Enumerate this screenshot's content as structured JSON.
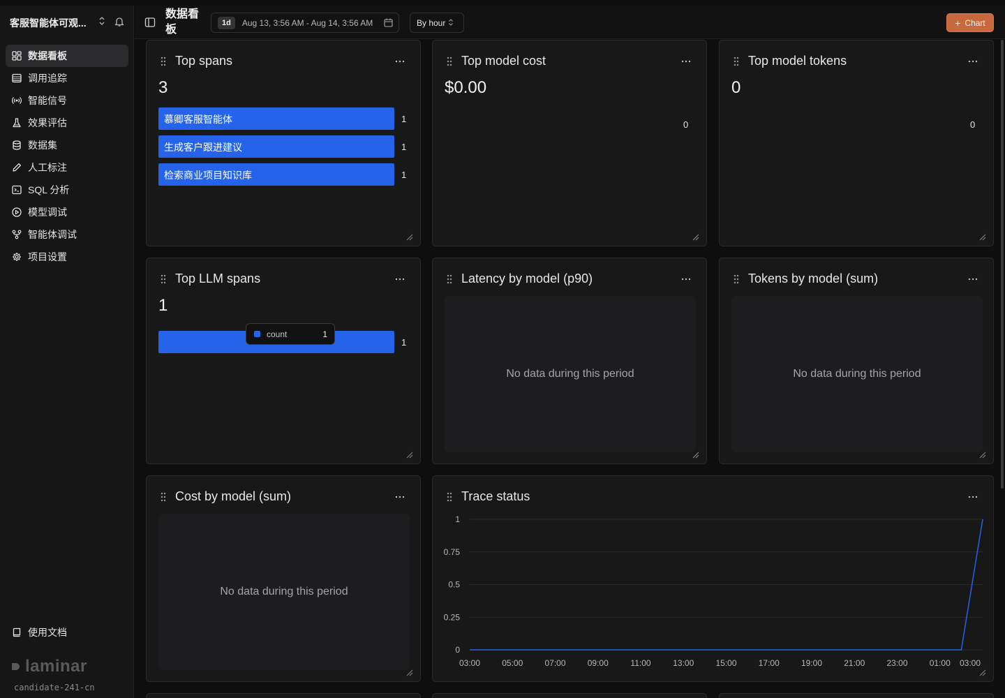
{
  "sidebar": {
    "project_name": "客服智能体可观...",
    "nav": [
      {
        "label": "数据看板",
        "icon": "dashboard-icon",
        "active": true
      },
      {
        "label": "调用追踪",
        "icon": "list-icon"
      },
      {
        "label": "智能信号",
        "icon": "radio-signal-icon"
      },
      {
        "label": "效果评估",
        "icon": "flask-icon"
      },
      {
        "label": "数据集",
        "icon": "database-icon"
      },
      {
        "label": "人工标注",
        "icon": "pencil-icon"
      },
      {
        "label": "SQL 分析",
        "icon": "terminal-icon"
      },
      {
        "label": "模型调试",
        "icon": "play-circle-icon"
      },
      {
        "label": "智能体调试",
        "icon": "git-branch-icon"
      },
      {
        "label": "项目设置",
        "icon": "gear-icon"
      }
    ],
    "docs_label": "使用文档",
    "logo_text": "laminar",
    "workspace": "candidate-241-cn"
  },
  "header": {
    "title": "数据看板",
    "range_chip": "1d",
    "range_text": "Aug 13, 3:56 AM - Aug 14, 3:56 AM",
    "group_by": "By hour",
    "add_chart_label": "Chart"
  },
  "cards": {
    "top_spans": {
      "title": "Top spans",
      "total": "3",
      "bars": [
        {
          "label": "慕卿客服智能体",
          "value": 1
        },
        {
          "label": "生成客户跟进建议",
          "value": 1
        },
        {
          "label": "检索商业项目知识库",
          "value": 1
        }
      ]
    },
    "top_model_cost": {
      "title": "Top model cost",
      "total": "$0.00",
      "bar_value": "0"
    },
    "top_model_tokens": {
      "title": "Top model tokens",
      "total": "0",
      "bar_value": "0"
    },
    "top_llm_spans": {
      "title": "Top LLM spans",
      "total": "1",
      "bar_value": 1,
      "tooltip_label": "count",
      "tooltip_value": "1"
    },
    "latency_by_model": {
      "title": "Latency by model (p90)",
      "empty": "No data during this period"
    },
    "tokens_by_model": {
      "title": "Tokens by model (sum)",
      "empty": "No data during this period"
    },
    "cost_by_model": {
      "title": "Cost by model (sum)",
      "empty": "No data during this period"
    },
    "trace_status": {
      "title": "Trace status"
    }
  },
  "chart_data": {
    "type": "line",
    "title": "Trace status",
    "x": [
      "03:00",
      "04:00",
      "05:00",
      "06:00",
      "07:00",
      "08:00",
      "09:00",
      "10:00",
      "11:00",
      "12:00",
      "13:00",
      "14:00",
      "15:00",
      "16:00",
      "17:00",
      "18:00",
      "19:00",
      "20:00",
      "21:00",
      "22:00",
      "23:00",
      "00:00",
      "01:00",
      "02:00",
      "03:00"
    ],
    "x_ticks": [
      "03:00",
      "05:00",
      "07:00",
      "09:00",
      "11:00",
      "13:00",
      "15:00",
      "17:00",
      "19:00",
      "21:00",
      "23:00",
      "01:00",
      "03:00"
    ],
    "y_ticks": [
      "0",
      "0.25",
      "0.5",
      "0.75",
      "1"
    ],
    "ylim": [
      0,
      1
    ],
    "series": [
      {
        "values": [
          0,
          0,
          0,
          0,
          0,
          0,
          0,
          0,
          0,
          0,
          0,
          0,
          0,
          0,
          0,
          0,
          0,
          0,
          0,
          0,
          0,
          0,
          0,
          0,
          1
        ],
        "color": "#2563eb"
      }
    ],
    "grid": true
  },
  "colors": {
    "accent": "#2563eb",
    "chart_button": "#c7683f"
  }
}
